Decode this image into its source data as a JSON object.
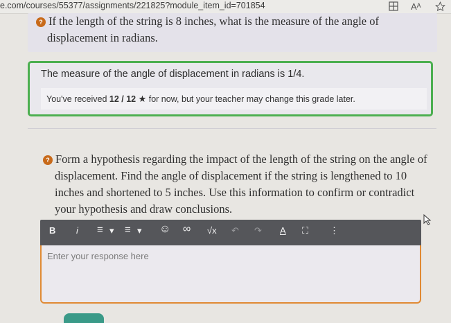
{
  "browser": {
    "url": "e.com/courses/55377/assignments/221825?module_item_id=701854",
    "icons": [
      "grid-icon",
      "text-size-icon",
      "star-outline-icon"
    ],
    "text_size_glyph": "Aᴬ"
  },
  "question1": {
    "badge": "?",
    "text_line1": "If the length of the string is 8 inches, what is the measure of the angle of",
    "text_line2": "displacement in radians.",
    "answer": "The measure of the angle of displacement in radians is 1/4.",
    "grade_prefix": "You've received",
    "grade_score": "12 / 12",
    "grade_suffix": "for now, but your teacher may change this grade later."
  },
  "question2": {
    "badge": "?",
    "lines": [
      "Form a hypothesis regarding the impact of the length of the string on the angle of",
      "displacement. Find the angle of displacement if the string is lengthened to 10",
      "inches and shortened to 5 inches. Use this information to confirm or contradict",
      "your hypothesis and draw conclusions."
    ]
  },
  "toolbar": {
    "bold": "B",
    "italic": "i",
    "bullet_list": "≡",
    "numbered_list": "≡",
    "dropdown": "▾",
    "emoji": "☺",
    "link": "∞",
    "sqrt": "√x",
    "undo": "↶",
    "redo": "↷",
    "clear_format": "A",
    "fullscreen": "⛶",
    "more": "⋮"
  },
  "editor": {
    "placeholder": "Enter your response here"
  },
  "colors": {
    "answer_border": "#4caf50",
    "editor_border": "#e08a33",
    "badge": "#c86a1a",
    "toolbar": "#55565a"
  }
}
